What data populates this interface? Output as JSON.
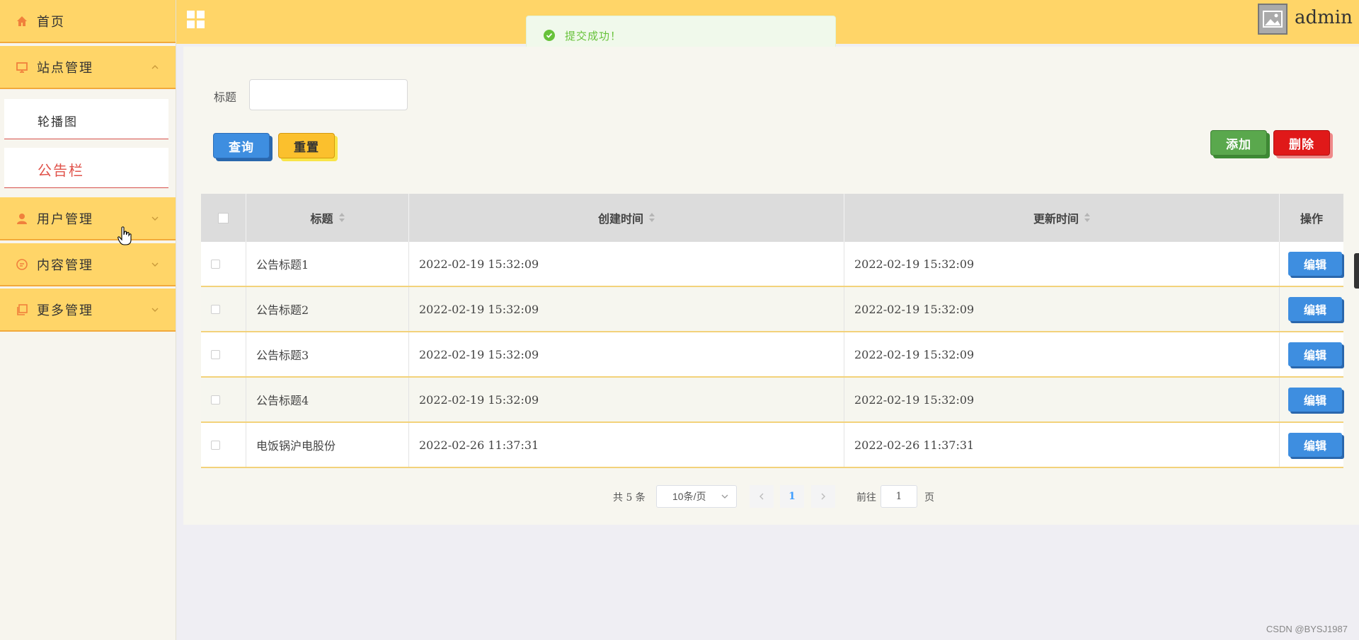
{
  "sidebar": {
    "items": [
      {
        "label": "首页",
        "icon": "home-icon"
      },
      {
        "label": "站点管理",
        "icon": "monitor-icon",
        "expanded": true,
        "children": [
          {
            "label": "轮播图"
          },
          {
            "label": "公告栏",
            "active": true
          }
        ]
      },
      {
        "label": "用户管理",
        "icon": "user-icon"
      },
      {
        "label": "内容管理",
        "icon": "comment-icon"
      },
      {
        "label": "更多管理",
        "icon": "copy-icon"
      }
    ]
  },
  "header": {
    "username": "admin"
  },
  "toast": {
    "message": "提交成功！",
    "type": "success"
  },
  "search": {
    "label": "标题",
    "value": "",
    "placeholder": ""
  },
  "buttons": {
    "query": "查询",
    "reset": "重置",
    "add": "添加",
    "delete": "删除"
  },
  "table": {
    "columns": [
      "标题",
      "创建时间",
      "更新时间",
      "操作"
    ],
    "rows": [
      {
        "title": "公告标题1",
        "created": "2022-02-19 15:32:09",
        "updated": "2022-02-19 15:32:09",
        "action": "编辑"
      },
      {
        "title": "公告标题2",
        "created": "2022-02-19 15:32:09",
        "updated": "2022-02-19 15:32:09",
        "action": "编辑"
      },
      {
        "title": "公告标题3",
        "created": "2022-02-19 15:32:09",
        "updated": "2022-02-19 15:32:09",
        "action": "编辑"
      },
      {
        "title": "公告标题4",
        "created": "2022-02-19 15:32:09",
        "updated": "2022-02-19 15:32:09",
        "action": "编辑"
      },
      {
        "title": "电饭锅沪电股份",
        "created": "2022-02-26 11:37:31",
        "updated": "2022-02-26 11:37:31",
        "action": "编辑"
      }
    ]
  },
  "pagination": {
    "total": "共 5 条",
    "page_size": "10条/页",
    "current_page": "1",
    "goto_label": "前往",
    "goto_value": "1",
    "page_unit": "页"
  },
  "watermark": "CSDN @BYSJ1987",
  "colors": {
    "theme_yellow": "#ffd568",
    "accent_orange": "#f2a93b",
    "primary_blue": "#3e8ee0",
    "add_green": "#5aa84d",
    "delete_red": "#e01919",
    "active_red": "#e0524a",
    "success_green": "#67c23a"
  }
}
